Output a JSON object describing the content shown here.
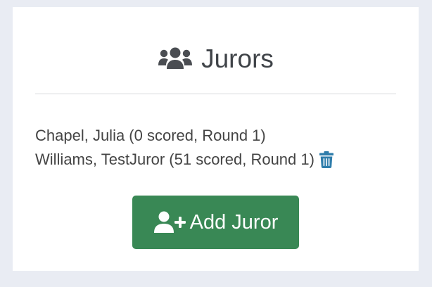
{
  "header": {
    "icon": "users-icon",
    "title": "Jurors"
  },
  "jurors": [
    {
      "text": "Chapel, Julia (0 scored, Round 1)",
      "deletable": false
    },
    {
      "text": "Williams, TestJuror (51 scored, Round 1)",
      "deletable": true,
      "delete_icon": "trash-icon"
    }
  ],
  "add_button": {
    "icon": "user-plus-icon",
    "label": "Add Juror"
  },
  "colors": {
    "background": "#e9ecf3",
    "card": "#ffffff",
    "button": "#398855",
    "trash": "#2f7dab",
    "text": "#444444"
  }
}
